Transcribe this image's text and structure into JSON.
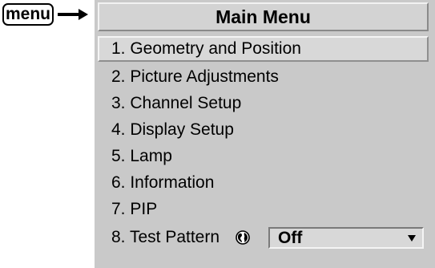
{
  "menu_key": {
    "label": "menu"
  },
  "main_menu": {
    "title": "Main Menu",
    "items": [
      {
        "label": "1. Geometry and Position"
      },
      {
        "label": "2. Picture Adjustments"
      },
      {
        "label": "3. Channel Setup"
      },
      {
        "label": "4. Display Setup"
      },
      {
        "label": "5. Lamp"
      },
      {
        "label": "6. Information"
      },
      {
        "label": "7. PIP"
      },
      {
        "label": "8. Test Pattern"
      }
    ],
    "test_pattern": {
      "icon": "globe-icon",
      "value": "Off"
    }
  },
  "colors": {
    "panel": "#c9c9c9",
    "highlight": "#d8d8d8",
    "text": "#000000"
  }
}
